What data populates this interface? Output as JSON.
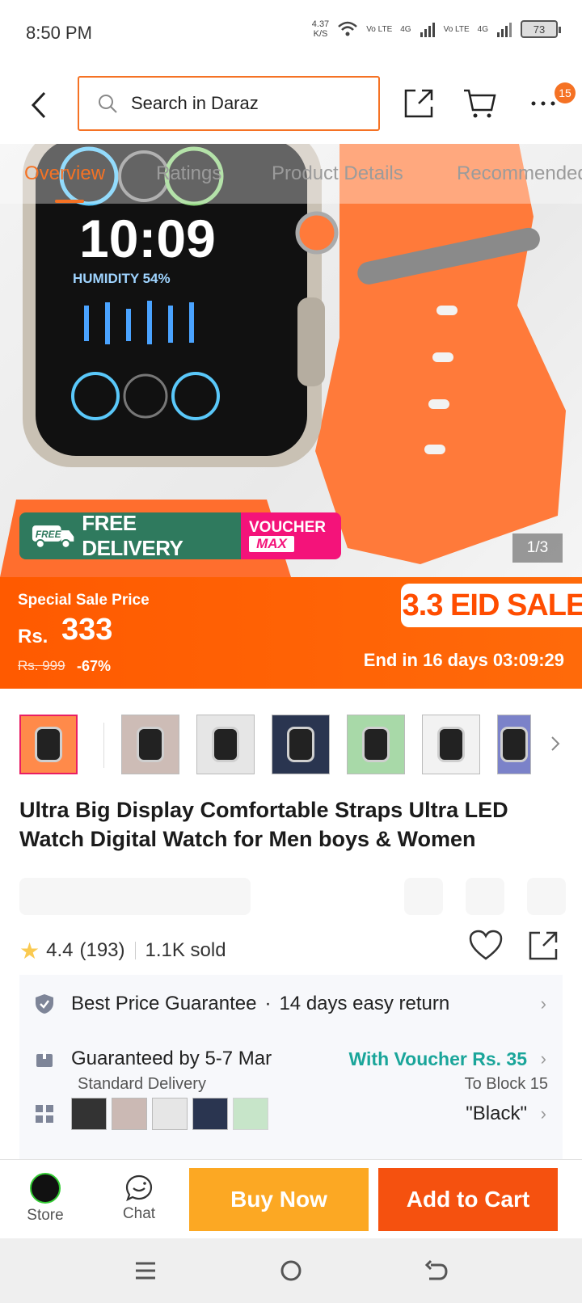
{
  "status": {
    "time": "8:50 PM",
    "speed_value": "4.37",
    "speed_unit": "K/S",
    "sim1": "Vo LTE",
    "sim1_net": "4G",
    "sim2": "Vo LTE",
    "sim2_net": "4G",
    "battery": "73"
  },
  "header": {
    "search_placeholder": "Search in Daraz",
    "badge": "15"
  },
  "tabs": [
    {
      "label": "Overview"
    },
    {
      "label": "Ratings"
    },
    {
      "label": "Product Details"
    },
    {
      "label": "Recommended"
    }
  ],
  "hero": {
    "counter": "1/3",
    "free_tag": "FREE",
    "free_delivery": "FREE DELIVERY",
    "voucher": "VOUCHER",
    "voucher_max": "MAX",
    "watch_time": "10:09",
    "watch_humidity": "HUMIDITY 54%"
  },
  "sale": {
    "label": "Special Sale Price",
    "currency": "Rs.",
    "price": "333",
    "old_price": "Rs. 999",
    "discount": "-67%",
    "banner": "3.3 EID SALE",
    "ends": "End in 16 days 03:09:29"
  },
  "product": {
    "title": "Ultra Big Display Comfortable Straps Ultra LED Watch Digital Watch for Men boys & Women",
    "rating": "4.4",
    "rating_count": "(193)",
    "sold": "1.1K sold"
  },
  "info": {
    "guarantee": "Best Price Guarantee",
    "return": "14 days easy return",
    "delivery": "Guaranteed by 5-7 Mar",
    "voucher": "With Voucher Rs. 35",
    "delivery_type": "Standard Delivery",
    "location": "To Block 15",
    "variant": "\"Black\""
  },
  "actions": {
    "store": "Store",
    "chat": "Chat",
    "buy_now": "Buy Now",
    "add_to_cart": "Add to Cart"
  },
  "colors": {
    "accent": "#f57224",
    "buy": "#fca823",
    "cart": "#f5510f",
    "teal": "#1aa59a"
  }
}
